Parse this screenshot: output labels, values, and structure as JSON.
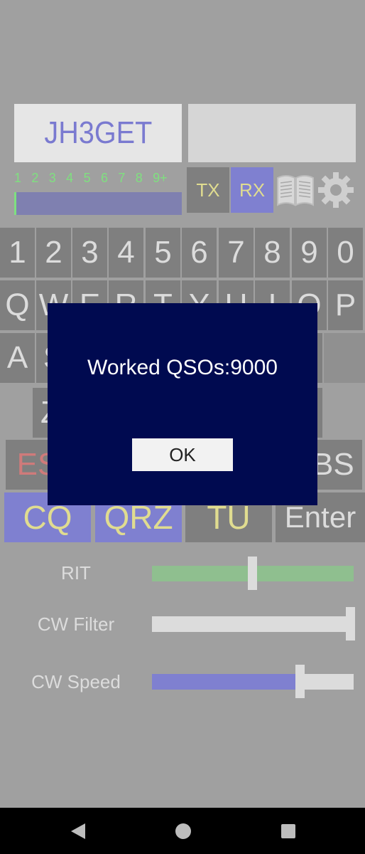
{
  "header": {
    "callsign": "JH3GET",
    "input_value": ""
  },
  "smeter": {
    "scale": [
      "1",
      "2",
      "3",
      "4",
      "5",
      "6",
      "7",
      "8",
      "9+"
    ],
    "level": 0.0
  },
  "controls": {
    "tx_label": "TX",
    "rx_label": "RX",
    "book_icon": "book-icon",
    "gear_icon": "gear-icon"
  },
  "keyboard": {
    "row_numbers": [
      "1",
      "2",
      "3",
      "4",
      "5",
      "6",
      "7",
      "8",
      "9",
      "0"
    ],
    "row_q": [
      "Q",
      "W",
      "E",
      "R",
      "T",
      "Y",
      "U",
      "I",
      "O",
      "P"
    ],
    "row_a_visible": [
      "A",
      "S"
    ],
    "row_z_visible": [
      "Z"
    ],
    "esc_label": "ES",
    "bs_label": "BS"
  },
  "function_keys": {
    "cq": "CQ",
    "qrz": "QRZ",
    "tu": "TU",
    "enter": "Enter"
  },
  "sliders": {
    "rit": {
      "label": "RIT",
      "value": 0.5
    },
    "cw_filter": {
      "label": "CW Filter",
      "value": 1.0
    },
    "cw_speed": {
      "label": "CW Speed",
      "value": 0.74
    }
  },
  "dialog": {
    "message": "Worked QSOs:9000",
    "ok_label": "OK"
  },
  "colors": {
    "background": "#a0a0a0",
    "dialog_bg": "#000a50",
    "accent_blue": "#7f80d0",
    "text_yellow": "#e0dc90",
    "rit_green": "#8fbf8f"
  }
}
